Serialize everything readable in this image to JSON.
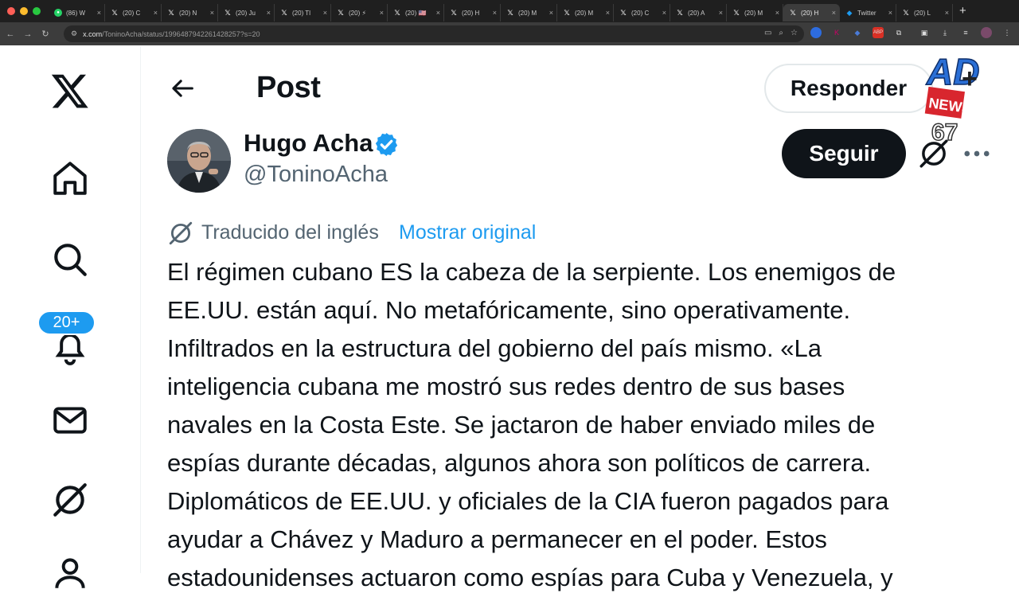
{
  "browser": {
    "tabs": [
      {
        "icon": "whatsapp-icon",
        "title": "(86) W"
      },
      {
        "icon": "x-icon",
        "title": "(20) C"
      },
      {
        "icon": "x-icon",
        "title": "(20) N"
      },
      {
        "icon": "x-icon",
        "title": "(20) Ju"
      },
      {
        "icon": "x-icon",
        "title": "(20) Tl"
      },
      {
        "icon": "x-icon",
        "title": "(20) ⚡"
      },
      {
        "icon": "x-icon",
        "title": "(20) 🇺🇸"
      },
      {
        "icon": "x-icon",
        "title": "(20) H"
      },
      {
        "icon": "x-icon",
        "title": "(20) M"
      },
      {
        "icon": "x-icon",
        "title": "(20) M"
      },
      {
        "icon": "x-icon",
        "title": "(20) C"
      },
      {
        "icon": "x-icon",
        "title": "(20) A"
      },
      {
        "icon": "x-icon",
        "title": "(20) M"
      },
      {
        "icon": "x-icon",
        "title": "(20) H"
      },
      {
        "icon": "twitter-icon",
        "title": "Twitter"
      },
      {
        "icon": "x-icon",
        "title": "(20) L"
      }
    ],
    "active_tab_index": 13,
    "url_host": "x.com",
    "url_path": "/ToninoAcha/status/1996487942261428257?s=20"
  },
  "sidebar": {
    "notification_badge": "20+"
  },
  "header": {
    "title": "Post",
    "reply_label": "Responder"
  },
  "author": {
    "name": "Hugo Acha",
    "handle": "@ToninoAcha",
    "verified": true,
    "follow_label": "Seguir"
  },
  "translation": {
    "label": "Traducido del inglés",
    "show_original": "Mostrar original"
  },
  "post": {
    "lines": [
      "El régimen cubano ES la cabeza de la serpiente. Los enemigos de",
      "EE.UU. están aquí. No metafóricamente, sino operativamente.",
      "Infiltrados en la estructura del gobierno del país mismo. «La",
      "inteligencia cubana me mostró sus redes dentro de sus bases",
      "navales en la Costa Este. Se jactaron de haber enviado miles de",
      "espías durante décadas, algunos ahora son políticos de carrera.",
      "Diplomáticos de EE.UU. y oficiales de la CIA fueron pagados para",
      "ayudar a Chávez y Maduro a permanecer en el poder. Estos",
      "estadounidenses actuaron como espías para Cuba y Venezuela, y"
    ]
  },
  "colors": {
    "accent": "#1d9bf0",
    "text": "#0f1419",
    "muted": "#536471"
  }
}
